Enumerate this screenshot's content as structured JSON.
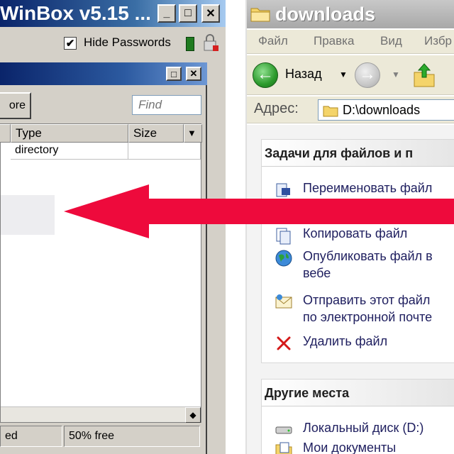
{
  "winbox": {
    "title": "WinBox v5.15 ...",
    "caption_buttons": {
      "minimize": "_",
      "maximize": "□",
      "close": "✕"
    },
    "hide_passwords_label": "Hide Passwords",
    "hide_passwords_checked": "✔",
    "files_window": {
      "caption_buttons": {
        "maximize": "□",
        "close": "✕"
      },
      "restore_button_label": "ore",
      "find_placeholder": "Find",
      "columns": [
        "Type",
        "Size"
      ],
      "rows": [
        {
          "type": "directory",
          "size": ""
        }
      ],
      "scroll_arrow": "◆",
      "status": [
        "ed",
        "50% free"
      ]
    }
  },
  "explorer": {
    "title": "downloads",
    "menu": [
      "Файл",
      "Правка",
      "Вид",
      "Избр"
    ],
    "toolbar": {
      "back_label": "Назад",
      "dropdown": "▼"
    },
    "address_label": "Адрес:",
    "address_value": "D:\\downloads",
    "file_tasks": {
      "header": "Задачи для файлов и п",
      "items": [
        {
          "label": "Переименовать файл",
          "icon": "rename-icon"
        },
        {
          "label": "Копировать файл",
          "icon": "copy-icon"
        },
        {
          "label": "Опубликовать файл в",
          "label2": "вебе",
          "icon": "web-publish-icon"
        },
        {
          "label": "Отправить этот файл",
          "label2": "по электронной почте",
          "icon": "email-icon"
        },
        {
          "label": "Удалить файл",
          "icon": "delete-icon"
        }
      ]
    },
    "other_places": {
      "header": "Другие места",
      "items": [
        {
          "label": "Локальный диск (D:)",
          "icon": "drive-icon"
        },
        {
          "label": "Мои документы",
          "icon": "my-documents-icon"
        }
      ]
    }
  },
  "colors": {
    "arrow": "#ee0a3c",
    "title_blue": "#0a246a",
    "task_text": "#202060"
  }
}
